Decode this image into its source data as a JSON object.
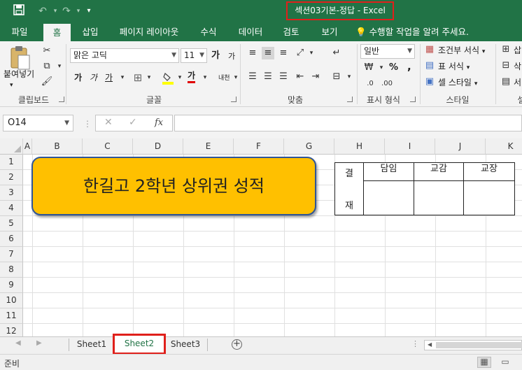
{
  "window": {
    "title": "섹션03기본-정답 - Excel"
  },
  "ribbon_tabs": [
    {
      "label": "파일"
    },
    {
      "label": "홈"
    },
    {
      "label": "삽입"
    },
    {
      "label": "페이지 레이아웃"
    },
    {
      "label": "수식"
    },
    {
      "label": "데이터"
    },
    {
      "label": "검토"
    },
    {
      "label": "보기"
    }
  ],
  "tell_me": "수행할 작업을 알려 주세요.",
  "clipboard": {
    "paste_label": "붙여넣기",
    "group_label": "클립보드"
  },
  "font": {
    "name": "맑은 고딕",
    "size": "11",
    "group_label": "글꼴",
    "bold": "가",
    "italic": "가",
    "underline": "가",
    "grow": "가",
    "shrink": "가",
    "color_letter": "가",
    "phonetic": "내천"
  },
  "alignment": {
    "group_label": "맞춤"
  },
  "number": {
    "format": "일반",
    "group_label": "표시 형식",
    "percent": "%",
    "comma": ","
  },
  "styles": {
    "conditional": "조건부 서식",
    "table": "표 서식",
    "cell": "셀 스타일",
    "group_label": "스타일"
  },
  "cells": {
    "insert": "삽",
    "delete": "삭",
    "format": "서",
    "group_label": "셀"
  },
  "formula_bar": {
    "name_box": "O14",
    "formula": ""
  },
  "columns": [
    "A",
    "B",
    "C",
    "D",
    "E",
    "F",
    "G",
    "H",
    "I",
    "J",
    "K"
  ],
  "rows": [
    "1",
    "2",
    "3",
    "4",
    "5",
    "6",
    "7",
    "8",
    "9",
    "10",
    "11",
    "12"
  ],
  "banner_text": "한길고 2학년 상위권 성적",
  "signoff_table": {
    "side_top": "결",
    "side_bottom": "재",
    "headers": [
      "담임",
      "교감",
      "교장"
    ]
  },
  "sheets": [
    {
      "label": "Sheet1",
      "active": false
    },
    {
      "label": "Sheet2",
      "active": true
    },
    {
      "label": "Sheet3",
      "active": false
    }
  ],
  "status": {
    "text": "준비"
  },
  "colors": {
    "excel_green": "#217346",
    "highlight": "#e0201b",
    "banner_fill": "#ffc000",
    "banner_border": "#2f5597"
  }
}
